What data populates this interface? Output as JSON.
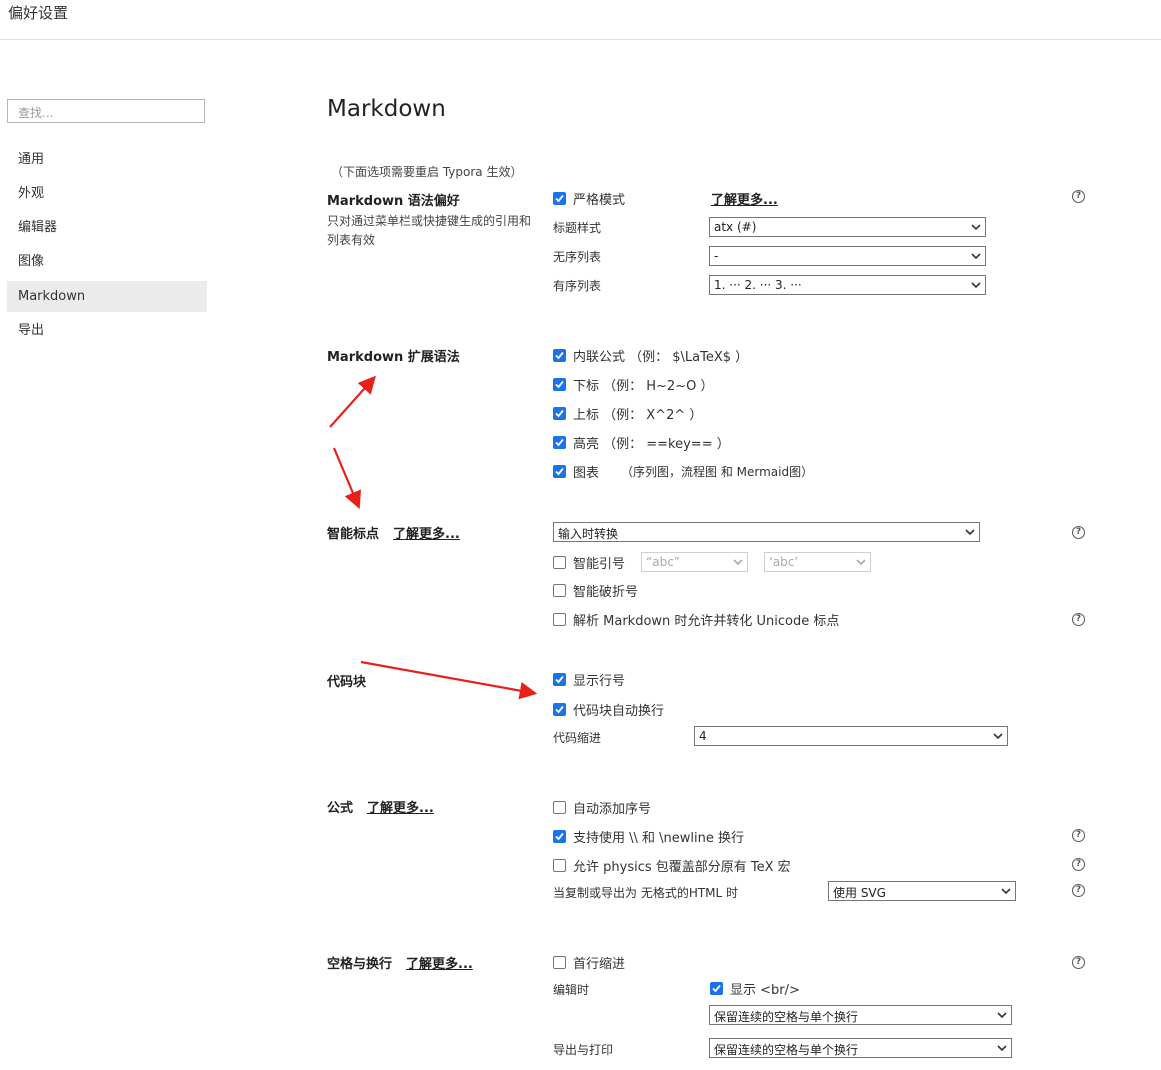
{
  "window": {
    "title": "偏好设置"
  },
  "sidebar": {
    "search_placeholder": "查找...",
    "items": [
      {
        "label": "通用"
      },
      {
        "label": "外观"
      },
      {
        "label": "编辑器"
      },
      {
        "label": "图像"
      },
      {
        "label": "Markdown",
        "active": true
      },
      {
        "label": "导出"
      }
    ]
  },
  "main": {
    "heading": "Markdown",
    "restart_note": "（下面选项需要重启 Typora 生效）",
    "learn_more": "了解更多...",
    "syntax_pref": {
      "title": "Markdown 语法偏好",
      "desc": "只对通过菜单栏或快捷键生成的引用和列表有效",
      "strict_mode": {
        "label": "严格模式",
        "checked": true
      },
      "heading_style": {
        "label": "标题样式",
        "value": "atx (#)"
      },
      "unordered_list": {
        "label": "无序列表",
        "value": "-"
      },
      "ordered_list": {
        "label": "有序列表",
        "value": "1. ··· 2. ··· 3. ···"
      }
    },
    "extended_syntax": {
      "title": "Markdown 扩展语法",
      "inline_math": {
        "label": "内联公式 （例： $\\LaTeX$ ）",
        "checked": true
      },
      "subscript": {
        "label": "下标 （例： H~2~O ）",
        "checked": true
      },
      "superscript": {
        "label": "上标 （例： X^2^ ）",
        "checked": true
      },
      "highlight": {
        "label": "高亮 （例： ==key== ）",
        "checked": true
      },
      "diagrams": {
        "label": "图表",
        "note": "（序列图，流程图 和 Mermaid图）",
        "checked": true
      }
    },
    "smart_punct": {
      "title": "智能标点",
      "mode": {
        "value": "输入时转换"
      },
      "smart_quotes": {
        "label": "智能引号",
        "checked": false,
        "double_value": "“abc”",
        "single_value": "‘abc’"
      },
      "smart_dash": {
        "label": "智能破折号",
        "checked": false
      },
      "unicode_punct": {
        "label": "解析 Markdown 时允许并转化 Unicode 标点",
        "checked": false
      }
    },
    "code_block": {
      "title": "代码块",
      "line_numbers": {
        "label": "显示行号",
        "checked": true
      },
      "wrap": {
        "label": "代码块自动换行",
        "checked": true
      },
      "indent": {
        "label": "代码缩进",
        "value": "4"
      }
    },
    "math": {
      "title": "公式",
      "auto_number": {
        "label": "自动添加序号",
        "checked": false
      },
      "newline": {
        "label": "支持使用 \\\\ 和 \\newline 换行",
        "checked": true
      },
      "physics": {
        "label": "允许 physics 包覆盖部分原有 TeX 宏",
        "checked": false
      },
      "export_html": {
        "label": "当复制或导出为 无格式的HTML 时",
        "value": "使用 SVG"
      }
    },
    "whitespace": {
      "title": "空格与换行",
      "indent_first": {
        "label": "首行缩进",
        "checked": false
      },
      "editing": {
        "label": "编辑时",
        "show_br": {
          "label": "显示 <br/>",
          "checked": true
        },
        "value": "保留连续的空格与单个换行"
      },
      "export": {
        "label": "导出与打印",
        "value": "保留连续的空格与单个换行"
      }
    }
  },
  "help_glyph": "?",
  "colors": {
    "accent": "#1a73e8",
    "annotation_arrow": "#e8201a",
    "active_nav": "#ebebeb"
  }
}
